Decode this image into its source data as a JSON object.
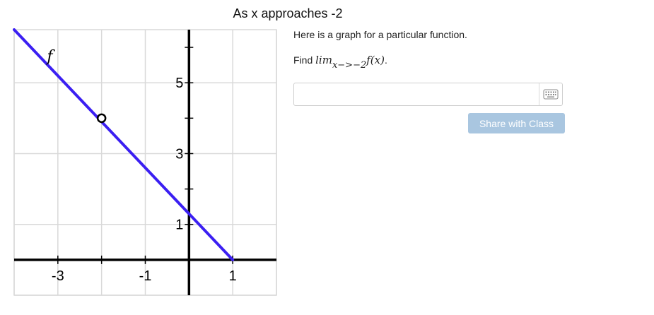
{
  "page": {
    "title": "As x approaches -2"
  },
  "problem": {
    "prompt": "Here is a graph for a particular function.",
    "find_label": "Find",
    "lim_text": "lim",
    "lim_subscript": "x−>−2",
    "expression": "f(x)",
    "period": "."
  },
  "answer": {
    "value": "",
    "placeholder": ""
  },
  "icons": {
    "keyboard": "keyboard-icon"
  },
  "buttons": {
    "share_label": "Share with Class"
  },
  "colors": {
    "line": "#3b1ff2",
    "share_button": "#a9c6e0"
  },
  "chart_data": {
    "type": "line",
    "function_label": "f",
    "series": [
      {
        "x": [
          -4,
          1
        ],
        "y": [
          6.5,
          0
        ]
      }
    ],
    "open_points": [
      {
        "x": -2,
        "y": 4
      }
    ],
    "x_tick_labels": [
      "-3",
      "-1",
      "1"
    ],
    "y_tick_labels": [
      "1",
      "3",
      "5"
    ],
    "xlim": [
      -4,
      2
    ],
    "ylim": [
      -1,
      6.5
    ],
    "grid": true
  }
}
